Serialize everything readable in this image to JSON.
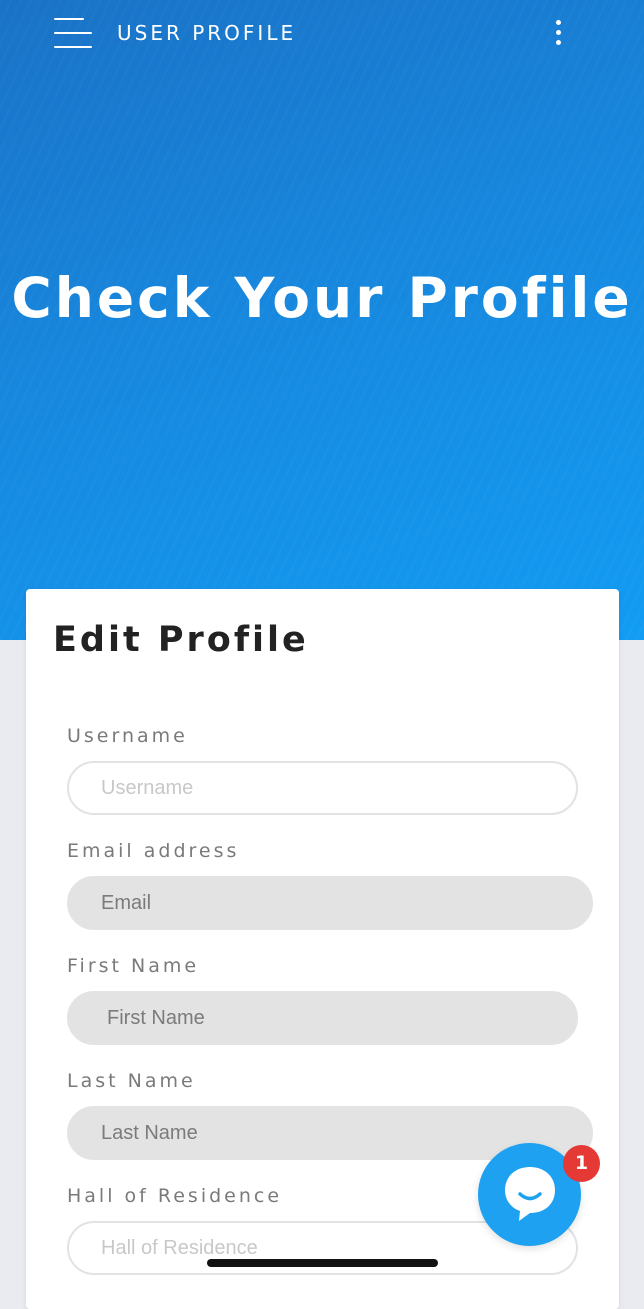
{
  "header": {
    "app_title": "USER PROFILE",
    "menu_icon": "hamburger-menu-icon",
    "more_icon": "more-vertical-icon"
  },
  "hero": {
    "title": "Check Your Profile",
    "gradient_start": "#1a72c6",
    "gradient_end": "#129cf3"
  },
  "form": {
    "title": "Edit Profile",
    "fields": [
      {
        "label": "Username",
        "placeholder": "Username",
        "value": ""
      },
      {
        "label": "Email address",
        "placeholder": "Email",
        "value": ""
      },
      {
        "label": "First Name",
        "placeholder": "First Name",
        "value": ""
      },
      {
        "label": "Last Name",
        "placeholder": "Last Name",
        "value": ""
      },
      {
        "label": "Hall of Residence",
        "placeholder": "Hall of Residence",
        "value": ""
      }
    ]
  },
  "chat": {
    "icon": "chat-bubble-icon",
    "badge_count": "1",
    "button_color": "#1ea1f1",
    "badge_color": "#e53935"
  }
}
